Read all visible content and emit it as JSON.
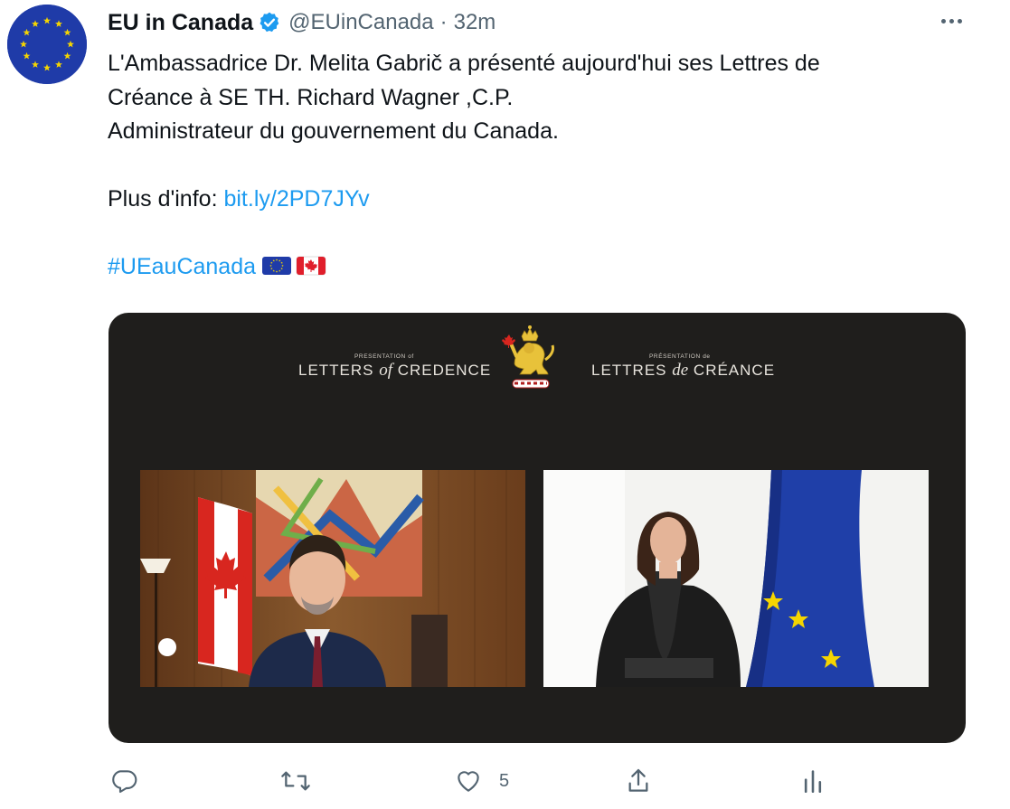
{
  "account": {
    "name": "EU in Canada",
    "handle": "@EUinCanada",
    "separator": "·",
    "time": "32m",
    "verified_icon": "verified-badge-icon",
    "avatar_icon": "eu-flag-avatar"
  },
  "tweet": {
    "line1": "L'Ambassadrice Dr. Melita Gabrič a présenté aujourd'hui ses Lettres de",
    "line2": "Créance à SE TH. Richard Wagner ,C.P.",
    "line3": "Administrateur du gouvernement du Canada.",
    "info_label": "Plus d'info: ",
    "info_link": "bit.ly/2PD7JYv",
    "hashtag": "#UEauCanada",
    "emojis": [
      "eu-flag-emoji",
      "canada-flag-emoji"
    ]
  },
  "media": {
    "left_small": "PRESENTATION of",
    "left_title_a": "LETTERS ",
    "left_title_em": "of",
    "left_title_b": " CREDENCE",
    "right_small": "PRÉSENTATION de",
    "right_title_a": "LETTRES ",
    "right_title_em": "de",
    "right_title_b": " CRÉANCE",
    "crest_icon": "governor-general-crest",
    "left_video": "video-feed-governor",
    "right_video": "video-feed-ambassador"
  },
  "actions": {
    "reply_icon": "reply-icon",
    "retweet_icon": "retweet-icon",
    "like_icon": "heart-icon",
    "like_count": "5",
    "share_icon": "share-icon",
    "analytics_icon": "analytics-icon"
  },
  "colors": {
    "link": "#1d9bf0",
    "secondary_text": "#536471",
    "eu_blue": "#1f3ba8",
    "eu_gold": "#f5d500",
    "media_bg": "#1f1e1c"
  }
}
